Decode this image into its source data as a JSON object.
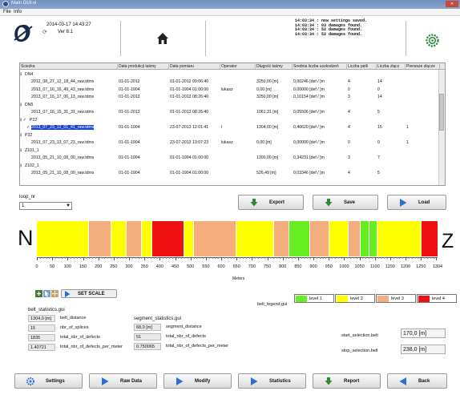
{
  "window": {
    "title": "Main GUI.vi",
    "close_label": "close"
  },
  "menu": [
    "File",
    "Info"
  ],
  "header": {
    "date": "2014-03-17 14:43:27",
    "version": "Ver 8.1",
    "status_log": "14:03:34 : new settings saved.\n14:03:34 : 03 damages found.\n14:03:34 : 52 damages found.\n14:03:34 : 52 damages found."
  },
  "tree": {
    "columns": [
      "Ścieżka",
      "Data produkcji taśmy",
      "Data pomiaru",
      "Operator",
      "Długość taśmy",
      "Średnia liczba uszkodzeń",
      "Liczba pętli",
      "Liczba złącz",
      "Pierwsze złącze"
    ],
    "rows": [
      {
        "indent": 1,
        "prefix": "⊟",
        "name": "DN4",
        "cells": [
          "",
          "",
          "",
          "",
          "",
          "",
          "",
          ""
        ]
      },
      {
        "indent": 2,
        "prefix": "",
        "name": "2012_08_27_12_18_44_raw.tdms",
        "cells": [
          "01-01-2012",
          "01-01-2012 09:06:40",
          "",
          "3250,00 [m]",
          "0,00246 [def / ]m",
          "4",
          "14",
          ""
        ]
      },
      {
        "indent": 2,
        "prefix": "",
        "name": "2013_07_16_16_49_43_raw.tdms",
        "cells": [
          "01-01-1904",
          "01-01-1904 01:00:00",
          "lukasz",
          "0,00 [m]",
          "0,00000 [def / ]m",
          "0",
          "0",
          ""
        ]
      },
      {
        "indent": 2,
        "prefix": "",
        "name": "2013_07_16_17_06_13_raw.tdms",
        "cells": [
          "01-01-2013",
          "01-01-2013 08:26:40",
          "",
          "3250,00 [m]",
          "0,10154 [def / ]m",
          "3",
          "14",
          ""
        ]
      },
      {
        "indent": 1,
        "prefix": "⊟",
        "name": "DN5",
        "cells": [
          "",
          "",
          "",
          "",
          "",
          "",
          "",
          ""
        ]
      },
      {
        "indent": 2,
        "prefix": "",
        "name": "2013_07_16_15_31_31_raw.tdms",
        "cells": [
          "01-01-2013",
          "01-01-2013 08:26:40",
          "",
          "1061,31 [m]",
          "0,05506 [def / ]m",
          "4",
          "5",
          ""
        ]
      },
      {
        "indent": 1,
        "prefix": "⊟ ✓",
        "name": "P22",
        "cells": [
          "",
          "",
          "",
          "",
          "",
          "",
          "",
          ""
        ]
      },
      {
        "indent": 2,
        "prefix": "✓",
        "name": "2013_07_23_12_01_41_raw.tdms",
        "selected": true,
        "cells": [
          "01-01-1904",
          "23-07-2013 12:01:41",
          "t",
          "1304,00 [m]",
          "0,40620 [def / ]m",
          "4",
          "15",
          "1"
        ]
      },
      {
        "indent": 1,
        "prefix": "⊟",
        "name": "P32",
        "cells": [
          "",
          "",
          "",
          "",
          "",
          "",
          "",
          ""
        ]
      },
      {
        "indent": 2,
        "prefix": "",
        "name": "2013_07_23_13_07_23_raw.tdms",
        "cells": [
          "01-01-1904",
          "23-07-2013 13:07:23",
          "lukasz",
          "0,00 [m]",
          "0,00000 [def / ]m",
          "0",
          "0",
          "1"
        ]
      },
      {
        "indent": 1,
        "prefix": "⊟",
        "name": "Z101_1",
        "cells": [
          "",
          "",
          "",
          "",
          "",
          "",
          "",
          ""
        ]
      },
      {
        "indent": 2,
        "prefix": "",
        "name": "2013_05_21_10_08_00_raw.tdms",
        "cells": [
          "01-01-1904",
          "01-01-1904 01:00:00",
          "",
          "1300,00 [m]",
          "0,34231 [def / ]m",
          "3",
          "7",
          ""
        ]
      },
      {
        "indent": 1,
        "prefix": "⊟",
        "name": "Z102_1",
        "cells": [
          "",
          "",
          "",
          "",
          "",
          "",
          "",
          ""
        ]
      },
      {
        "indent": 2,
        "prefix": "",
        "name": "2013_05_21_10_08_00_raw.tdms",
        "cells": [
          "01-01-1904",
          "01-01-1904 01:00:00",
          "",
          "526,49 [m]",
          "0,03346 [def / ]m",
          "4",
          "5",
          ""
        ]
      }
    ]
  },
  "loop": {
    "label": "loop_nr",
    "value": "1"
  },
  "actions": {
    "export": "Export",
    "save": "Save",
    "load": "Load"
  },
  "belt": {
    "start_label": "N",
    "end_label": "Z",
    "axis_title": "Meters",
    "axis_max": 1304,
    "ticks": [
      0,
      50,
      100,
      150,
      200,
      250,
      300,
      350,
      400,
      450,
      500,
      550,
      600,
      650,
      700,
      750,
      800,
      850,
      900,
      950,
      1000,
      1050,
      1100,
      1150,
      1200,
      1250,
      1304
    ],
    "segments": [
      {
        "from": 0,
        "to": 168,
        "level": 2
      },
      {
        "from": 168,
        "to": 240,
        "level": 3
      },
      {
        "from": 240,
        "to": 290,
        "level": 2
      },
      {
        "from": 290,
        "to": 340,
        "level": 3
      },
      {
        "from": 340,
        "to": 372,
        "level": 2
      },
      {
        "from": 372,
        "to": 478,
        "level": 4
      },
      {
        "from": 478,
        "to": 508,
        "level": 2
      },
      {
        "from": 508,
        "to": 648,
        "level": 3
      },
      {
        "from": 648,
        "to": 770,
        "level": 2
      },
      {
        "from": 770,
        "to": 820,
        "level": 3
      },
      {
        "from": 820,
        "to": 888,
        "level": 1
      },
      {
        "from": 888,
        "to": 950,
        "level": 3
      },
      {
        "from": 950,
        "to": 1012,
        "level": 2
      },
      {
        "from": 1012,
        "to": 1050,
        "level": 3
      },
      {
        "from": 1050,
        "to": 1105,
        "level": 1
      },
      {
        "from": 1105,
        "to": 1248,
        "level": 2
      },
      {
        "from": 1248,
        "to": 1304,
        "level": 4
      }
    ],
    "splices": [
      168,
      240,
      290,
      340,
      372,
      478,
      508,
      648,
      770,
      820,
      888,
      950,
      1012,
      1050,
      1080,
      1105,
      1248
    ]
  },
  "scale_button": "SET SCALE",
  "belt_stats": {
    "title": "belt_statistics.gui",
    "rows": [
      {
        "value": "1304,0 [m]",
        "name": "belt_distance"
      },
      {
        "value": "15",
        "name": "nbr_of_splices"
      },
      {
        "value": "1835",
        "name": "total_nbr_of_defects"
      },
      {
        "value": "1.40721",
        "name": "total_nbr_of_defects_per_meter"
      }
    ]
  },
  "segment_stats": {
    "title": "segment_statistics.gui",
    "rows": [
      {
        "value": "68,0 [m]",
        "name": "segment_distance"
      },
      {
        "value": "51",
        "name": "total_nbr_of_defects"
      },
      {
        "value": "0.750065",
        "name": "total_nbr_of_defects_per_meter"
      }
    ]
  },
  "legend": {
    "label": "belt_legend.gui",
    "levels": [
      {
        "name": "level 1",
        "color": "#66ee22"
      },
      {
        "name": "level 2",
        "color": "#ffff00"
      },
      {
        "name": "level 3",
        "color": "#f4ad7c"
      },
      {
        "name": "level 4",
        "color": "#ee1111"
      }
    ]
  },
  "selection": {
    "start_label": "start_selection.belt",
    "start_value": "170,0 [m]",
    "stop_label": "stop_selection.belt",
    "stop_value": "238,0 [m]"
  },
  "bottom_buttons": [
    "Settings",
    "Raw Data",
    "Modify",
    "Statistics",
    "Report",
    "Back"
  ]
}
